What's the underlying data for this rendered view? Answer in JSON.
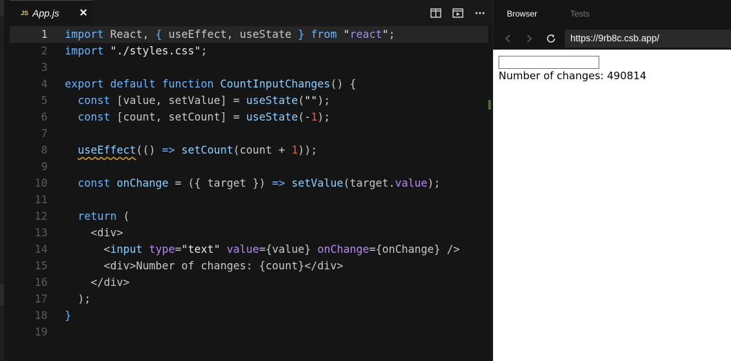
{
  "editor": {
    "tab": {
      "badge": "JS",
      "filename": "App.js"
    },
    "icons": [
      "split-view-icon",
      "preview-icon",
      "more-icon"
    ],
    "code_lines": [
      [
        [
          "kw",
          "import"
        ],
        [
          "p",
          " React, "
        ],
        [
          "kw",
          "{"
        ],
        [
          "p",
          " useEffect, useState "
        ],
        [
          "kw",
          "}"
        ],
        [
          "p",
          " "
        ],
        [
          "kw",
          "from"
        ],
        [
          "p",
          " "
        ],
        [
          "str",
          "\""
        ],
        [
          "strv",
          "react"
        ],
        [
          "str",
          "\""
        ],
        [
          "p",
          ";"
        ]
      ],
      [
        [
          "kw",
          "import"
        ],
        [
          "p",
          " "
        ],
        [
          "str",
          "\"./styles.css\""
        ],
        [
          "p",
          ";"
        ]
      ],
      [],
      [
        [
          "kw",
          "export"
        ],
        [
          "p",
          " "
        ],
        [
          "kw",
          "default"
        ],
        [
          "p",
          " "
        ],
        [
          "kw",
          "function"
        ],
        [
          "p",
          " "
        ],
        [
          "fn",
          "CountInputChanges"
        ],
        [
          "p",
          "() {"
        ]
      ],
      [
        [
          "p",
          "  "
        ],
        [
          "kw",
          "const"
        ],
        [
          "p",
          " [value, setValue] = "
        ],
        [
          "fn",
          "useState"
        ],
        [
          "p",
          "("
        ],
        [
          "str",
          "\"\""
        ],
        [
          "p",
          ");"
        ]
      ],
      [
        [
          "p",
          "  "
        ],
        [
          "kw",
          "const"
        ],
        [
          "p",
          " [count, setCount] = "
        ],
        [
          "fn",
          "useState"
        ],
        [
          "p",
          "(-"
        ],
        [
          "num",
          "1"
        ],
        [
          "p",
          ");"
        ]
      ],
      [],
      [
        [
          "p",
          "  "
        ],
        [
          "sq",
          "useEffect"
        ],
        [
          "p",
          "(() "
        ],
        [
          "kw",
          "=>"
        ],
        [
          "p",
          " "
        ],
        [
          "fn",
          "setCount"
        ],
        [
          "p",
          "(count + "
        ],
        [
          "num",
          "1"
        ],
        [
          "p",
          "));"
        ]
      ],
      [],
      [
        [
          "p",
          "  "
        ],
        [
          "kw",
          "const"
        ],
        [
          "p",
          " "
        ],
        [
          "fn",
          "onChange"
        ],
        [
          "p",
          " = ({ target }) "
        ],
        [
          "kw",
          "=>"
        ],
        [
          "p",
          " "
        ],
        [
          "fn",
          "setValue"
        ],
        [
          "p",
          "(target."
        ],
        [
          "attr",
          "value"
        ],
        [
          "p",
          ");"
        ]
      ],
      [],
      [
        [
          "p",
          "  "
        ],
        [
          "kw",
          "return"
        ],
        [
          "p",
          " ("
        ]
      ],
      [
        [
          "p",
          "    <div>"
        ]
      ],
      [
        [
          "p",
          "      <"
        ],
        [
          "fn",
          "input"
        ],
        [
          "p",
          " "
        ],
        [
          "attr",
          "type"
        ],
        [
          "p",
          "="
        ],
        [
          "str",
          "\"text\""
        ],
        [
          "p",
          " "
        ],
        [
          "attr",
          "value"
        ],
        [
          "p",
          "={value} "
        ],
        [
          "attr",
          "onChange"
        ],
        [
          "p",
          "={onChange} />"
        ]
      ],
      [
        [
          "p",
          "      <div>Number of changes: {count}</div>"
        ]
      ],
      [
        [
          "p",
          "    </div>"
        ]
      ],
      [
        [
          "p",
          "  );"
        ]
      ],
      [
        [
          "kw",
          "}"
        ]
      ],
      []
    ]
  },
  "browser": {
    "tabs": {
      "browser": "Browser",
      "tests": "Tests"
    },
    "url": "https://9rb8c.csb.app/",
    "preview": {
      "input_value": "",
      "count_text": "Number of changes: 490814"
    }
  }
}
